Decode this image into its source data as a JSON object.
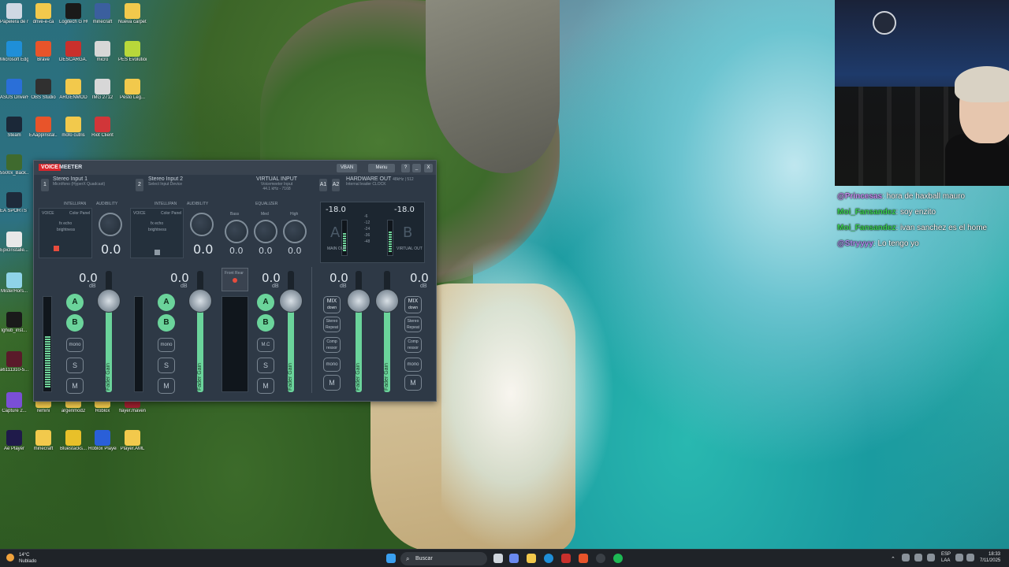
{
  "desktop": {
    "icons": [
      {
        "label": "Papelera de reciclaje",
        "color": "#cfd8e3"
      },
      {
        "label": "drive-e-ca",
        "color": "#f2c94c"
      },
      {
        "label": "Logitech G HUB",
        "color": "#1a1a1a"
      },
      {
        "label": "minecraft",
        "color": "#3b5f9e"
      },
      {
        "label": "Nueva carpeta",
        "color": "#f2c94c"
      },
      {
        "label": "Microsoft Edge",
        "color": "#1f8fd8"
      },
      {
        "label": "Brave",
        "color": "#e8542a"
      },
      {
        "label": "DESCARGA...",
        "color": "#c9302c"
      },
      {
        "label": "micro",
        "color": "#d7d7d7"
      },
      {
        "label": "PES Evolution Soccer",
        "color": "#b8d83a"
      },
      {
        "label": "ASUS DriverHub",
        "color": "#2a6fd8"
      },
      {
        "label": "OBS Studio",
        "color": "#303030"
      },
      {
        "label": "ARGENMOD",
        "color": "#f2c94c"
      },
      {
        "label": "IMG 2712",
        "color": "#d7d7d7"
      },
      {
        "label": "Pesto Leg...",
        "color": "#f2c94c"
      },
      {
        "label": "Steam",
        "color": "#1b2838"
      },
      {
        "label": "EAappInstal...",
        "color": "#e8542a"
      },
      {
        "label": "mofo cutris",
        "color": "#f2c94c"
      },
      {
        "label": "Riot Client",
        "color": "#d13639"
      },
      {
        "label": "5500x_Back...",
        "color": "#3f6a2e"
      },
      {
        "label": "EA SPORTS FC 25",
        "color": "#1e2a3a"
      },
      {
        "label": "EpicInstalle...",
        "color": "#e8e8e8"
      },
      {
        "label": "MisterHors...",
        "color": "#8fd3e8"
      },
      {
        "label": "lghub_inst...",
        "color": "#1a1a1a"
      },
      {
        "label": "a6111310-5...",
        "color": "#5a1a2a"
      },
      {
        "label": "Capture 2...",
        "color": "#7a4fd6"
      },
      {
        "label": "remini",
        "color": "#f2c94c"
      },
      {
        "label": "argenmod2",
        "color": "#f2c94c"
      },
      {
        "label": "Roblox",
        "color": "#f2c94c"
      },
      {
        "label": "flayer.maven",
        "color": "#a02030"
      },
      {
        "label": "Ae Player",
        "color": "#1f1a4a"
      },
      {
        "label": "minecraft",
        "color": "#f2c94c"
      },
      {
        "label": "Bluestacks...",
        "color": "#e8c02a"
      },
      {
        "label": "Roblox Player",
        "color": "#2a5fd8"
      },
      {
        "label": "Player.AML",
        "color": "#f2c94c"
      }
    ]
  },
  "chat": [
    {
      "user": "@Princesas",
      "user_color": "#c98cf2",
      "text": "hora de haxball mauro"
    },
    {
      "user": "Moi_Fansandez",
      "user_color": "#3ad14f",
      "text": "soy enzito"
    },
    {
      "user": "Moi_Fansandez",
      "user_color": "#3ad14f",
      "text": "ivan sanchez es el home"
    },
    {
      "user": "@Stryyyy",
      "user_color": "#b38af0",
      "text": "Lo tengo yo"
    }
  ],
  "voicemeeter": {
    "logo_voice": "VOICE",
    "logo_meeter": "MEETER",
    "vban_label": "VBAN",
    "menu_label": "Menu",
    "help_label": "?",
    "minimize_label": "_",
    "close_label": "X",
    "strip1": {
      "num": "1",
      "name": "Stereo Input 1",
      "device": "Micrófono (HyperX Quadcast)",
      "intellipan": "INTELLIPAN",
      "voice": "VOICE",
      "color_panel": "Color Panel",
      "fx_echo": "fx echo",
      "brightness": "brightness",
      "audibility": "AUDIBILITY",
      "audibility_value": "0.0",
      "gain": "0.0",
      "db": "dB",
      "fader_label": "Fader Gain",
      "a_label": "A",
      "b_label": "B",
      "mono": "mono",
      "solo": "S",
      "mute": "M"
    },
    "strip2": {
      "num": "2",
      "name": "Stereo Input 2",
      "device": "Select Input Device",
      "intellipan": "INTELLIPAN",
      "voice": "VOICE",
      "color_panel": "Color Panel",
      "fx_echo": "fx echo",
      "brightness": "brightness",
      "audibility": "AUDIBILITY",
      "audibility_value": "0.0",
      "gain": "0.0",
      "db": "dB",
      "fader_label": "Fader Gain",
      "a_label": "A",
      "b_label": "B",
      "mono": "mono",
      "solo": "S",
      "mute": "M"
    },
    "virtual": {
      "title": "VIRTUAL INPUT",
      "device": "Voicemeeter Input",
      "sub": "44.1 kHz - 7168",
      "equalizer": "EQUALIZER",
      "bass": "Bass",
      "med": "Med",
      "high": "High",
      "bass_val": "0.0",
      "med_val": "0.0",
      "high_val": "0.0",
      "gain": "0.0",
      "db": "dB",
      "fader_label": "Fader Gain",
      "a_label": "A",
      "b_label": "B",
      "mc": "M.C",
      "solo": "S",
      "mute": "M",
      "fx_label": "Front Rear"
    },
    "hardware": {
      "a1": "A1",
      "a2": "A2",
      "title": "HARDWARE OUT",
      "rate": "48kHz | 512",
      "device": "Internal leader CLOCK",
      "level_a": "-18.0",
      "level_b": "-18.0",
      "db": "dB",
      "a_label": "A",
      "b_label": "B",
      "main_out": "MAIN OUT",
      "virtual_out": "VIRTUAL OUT",
      "scale": [
        "-6",
        "-12",
        "-24",
        "-36",
        "-48"
      ]
    },
    "bus_a": {
      "gain": "0.0",
      "db": "dB",
      "mix": "MIX",
      "mix_sub": "down",
      "stereo_repeat": "Stereo Repeat",
      "comp": "Comp ressor",
      "mono": "mono",
      "mute": "M",
      "fader_label": "Fader Gain"
    },
    "bus_b": {
      "gain": "0.0",
      "db": "dB",
      "mix": "MIX",
      "mix_sub": "down",
      "stereo_repeat": "Stereo Repeat",
      "comp": "Comp ressor",
      "mono": "mono",
      "mute": "M",
      "fader_label": "Fader Gain"
    }
  },
  "taskbar": {
    "weather_temp": "14°C",
    "weather_desc": "Nublado",
    "search_placeholder": "Buscar",
    "lang": "ESP",
    "lang_sub": "LAA",
    "time": "18:33",
    "date": "7/11/2025"
  }
}
